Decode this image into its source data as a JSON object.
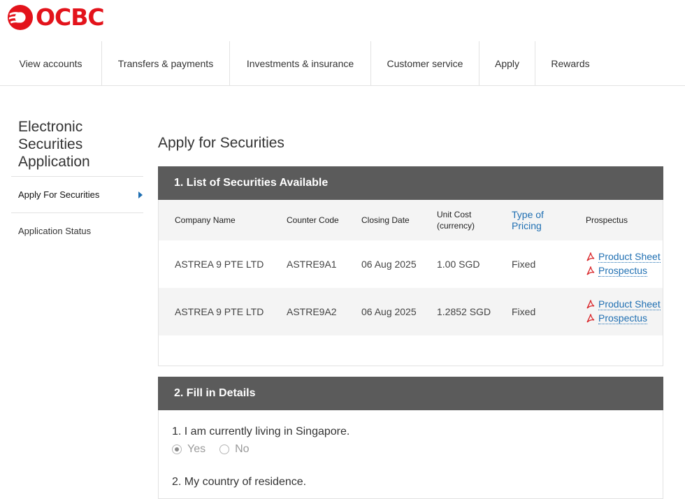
{
  "brand": {
    "name": "OCBC",
    "color": "#e3131b"
  },
  "nav": {
    "items": [
      {
        "label": "View accounts"
      },
      {
        "label": "Transfers & payments"
      },
      {
        "label": "Investments & insurance"
      },
      {
        "label": "Customer service"
      },
      {
        "label": "Apply"
      },
      {
        "label": "Rewards"
      }
    ]
  },
  "sidebar": {
    "title": "Electronic Securities Application",
    "items": [
      {
        "label": "Apply For Securities",
        "active": true
      },
      {
        "label": "Application Status",
        "active": false
      }
    ]
  },
  "main": {
    "title": "Apply for Securities",
    "section1": {
      "heading": "1. List of Securities Available",
      "columns": [
        "Company Name",
        "Counter Code",
        "Closing Date",
        "Unit Cost (currency)",
        "Type of Pricing",
        "Prospectus"
      ],
      "rows": [
        {
          "company": "ASTREA 9 PTE LTD",
          "code": "ASTRE9A1",
          "closing": "06 Aug 2025",
          "unit_cost": "1.00 SGD",
          "pricing": "Fixed",
          "links": [
            "Product Sheet",
            "Prospectus"
          ]
        },
        {
          "company": "ASTREA 9 PTE LTD",
          "code": "ASTRE9A2",
          "closing": "06 Aug 2025",
          "unit_cost": "1.2852 SGD",
          "pricing": "Fixed",
          "links": [
            "Product Sheet",
            "Prospectus"
          ]
        }
      ]
    },
    "section2": {
      "heading": "2. Fill in Details",
      "q1": "1. I am currently living in Singapore.",
      "options": [
        {
          "label": "Yes",
          "selected": true
        },
        {
          "label": "No",
          "selected": false
        }
      ],
      "q2": "2. My country of residence."
    }
  },
  "colors": {
    "link": "#1f6fb2",
    "panel_header": "#5b5b5b",
    "row_alt": "#f4f4f4"
  },
  "icons": {
    "pdf": "pdf-icon",
    "arrow": "caret-right-icon"
  }
}
